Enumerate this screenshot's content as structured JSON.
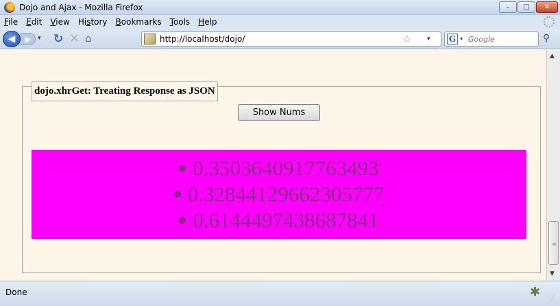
{
  "window": {
    "title": "Dojo and Ajax - Mozilla Firefox",
    "minimize_glyph": "–",
    "maximize_glyph": "□",
    "close_glyph": "✕"
  },
  "menu": {
    "items": [
      {
        "u": "F",
        "rest": "ile"
      },
      {
        "u": "E",
        "rest": "dit"
      },
      {
        "u": "V",
        "rest": "iew"
      },
      {
        "pre": "Hi",
        "u": "s",
        "rest": "tory"
      },
      {
        "u": "B",
        "rest": "ookmarks"
      },
      {
        "u": "T",
        "rest": "ools"
      },
      {
        "u": "H",
        "rest": "elp"
      }
    ]
  },
  "nav": {
    "back_glyph": "◀",
    "forward_glyph": "▶",
    "dropdown_glyph": "▾",
    "reload_glyph": "↻",
    "stop_glyph": "✕",
    "home_glyph": "⌂",
    "url": "http://localhost/dojo/",
    "bookmark_star_glyph": "☆",
    "search_engine_glyph": "G",
    "search_placeholder": "Google",
    "search_go_glyph": "⚲"
  },
  "page": {
    "legend": "dojo.xhrGet: Treating Response as JSON",
    "show_button": "Show Nums",
    "numbers": [
      "0.3503640917763493",
      "0.32844129662305777",
      "0.6144497438687841"
    ],
    "numbers_background": "#ff00ff",
    "page_background": "#fdf6e8"
  },
  "status": {
    "text": "Done"
  }
}
